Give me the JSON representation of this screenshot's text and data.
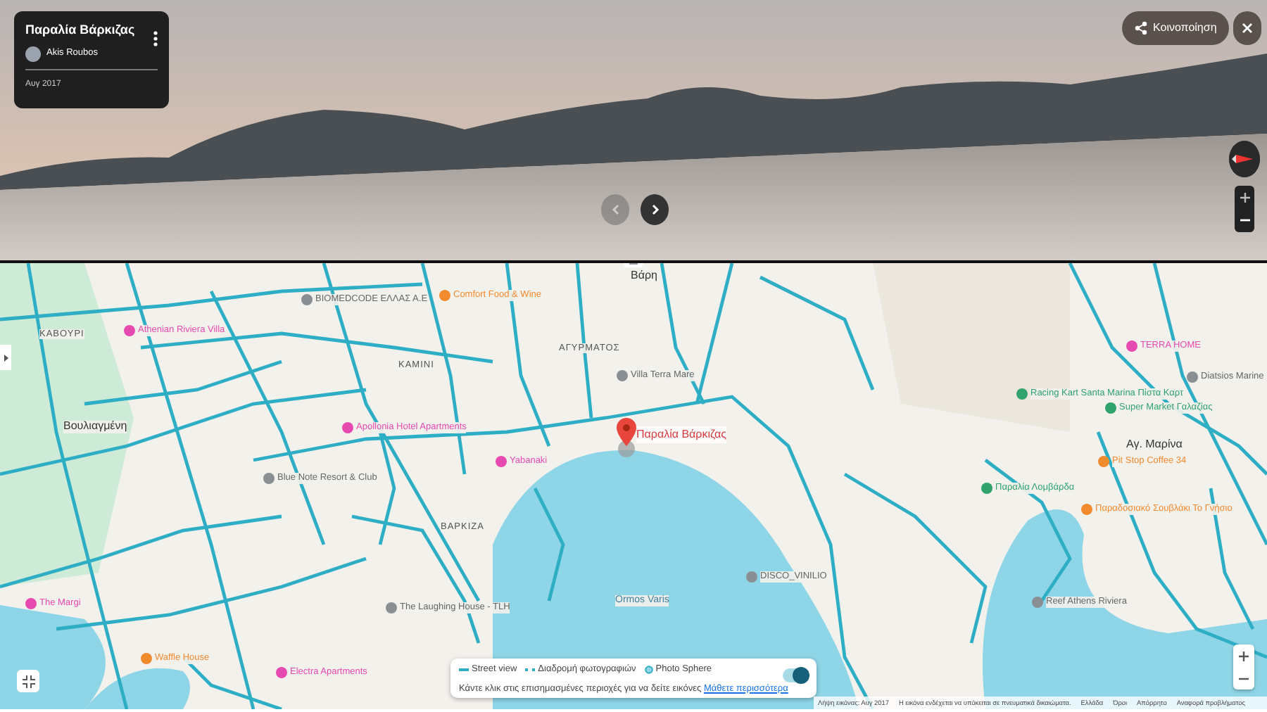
{
  "street_view": {
    "title": "Παραλία Βάρκιζας",
    "author": "Akis Roubos",
    "date": "Αυγ 2017",
    "share_label": "Κοινοποίηση",
    "nav": [
      {
        "kind": "prev",
        "disabled": true
      },
      {
        "kind": "next",
        "disabled": false
      }
    ]
  },
  "map": {
    "pin_label": "Παραλία Βάρκιζας",
    "places": [
      {
        "name": "Βάρη",
        "kind": "town"
      },
      {
        "name": "Comfort Food & Wine",
        "kind": "poi",
        "color": "#f28a2e"
      },
      {
        "name": "BIOMEDCODE ΕΛΛΑΣ Α.Ε",
        "kind": "poi",
        "color": "#8a8f94"
      },
      {
        "name": "Athenian Riviera Villa",
        "kind": "poi",
        "color": "#e64ab0"
      },
      {
        "name": "ΚΑΒΟΥΡΙ",
        "kind": "area"
      },
      {
        "name": "TERRA HOME",
        "kind": "poi",
        "color": "#e64ab0"
      },
      {
        "name": "ΑΓΥΡΜΑΤΟΣ",
        "kind": "area"
      },
      {
        "name": "ΚΑΜΙΝΙ",
        "kind": "area"
      },
      {
        "name": "Villa Terra Mare",
        "kind": "poi",
        "color": "#8a8f94"
      },
      {
        "name": "Diatsios Marine",
        "kind": "poi",
        "color": "#8a8f94"
      },
      {
        "name": "Racing Kart Santa Marina Πίστα Καρτ",
        "kind": "poi",
        "color": "#2fa36b"
      },
      {
        "name": "Super Market Γαλαζίας",
        "kind": "poi",
        "color": "#2fa36b"
      },
      {
        "name": "Βουλιαγμένη",
        "kind": "town"
      },
      {
        "name": "Apollonia Hotel Apartments",
        "kind": "poi",
        "color": "#e64ab0"
      },
      {
        "name": "Αγ. Μαρίνα",
        "kind": "town"
      },
      {
        "name": "Yabanaki",
        "kind": "poi",
        "color": "#e64ab0"
      },
      {
        "name": "Pit Stop Coffee 34",
        "kind": "poi",
        "color": "#f28a2e"
      },
      {
        "name": "Blue Note Resort & Club",
        "kind": "poi",
        "color": "#8a8f94"
      },
      {
        "name": "Παραλία Λομβάρδα",
        "kind": "poi",
        "color": "#2fa36b"
      },
      {
        "name": "Παραδοσιακό Σουβλάκι Το Γνήσιο",
        "kind": "poi",
        "color": "#f28a2e"
      },
      {
        "name": "ΒΑΡΚΙΖΑ",
        "kind": "area"
      },
      {
        "name": "DISCO_VINILIO",
        "kind": "poi",
        "color": "#8a8f94"
      },
      {
        "name": "The Margi",
        "kind": "poi",
        "color": "#e64ab0"
      },
      {
        "name": "The Laughing House - TLH",
        "kind": "poi",
        "color": "#8a8f94"
      },
      {
        "name": "Ormos Varis",
        "kind": "water"
      },
      {
        "name": "Reef Athens Riviera",
        "kind": "poi",
        "color": "#8a8f94"
      },
      {
        "name": "Waffle House",
        "kind": "poi",
        "color": "#f28a2e"
      },
      {
        "name": "Electra Apartments",
        "kind": "poi",
        "color": "#e64ab0"
      }
    ]
  },
  "legend": {
    "items": [
      {
        "label": "Street view",
        "kind": "line"
      },
      {
        "label": "Διαδρομή φωτογραφιών",
        "kind": "dotted"
      },
      {
        "label": "Photo Sphere",
        "kind": "circle"
      }
    ],
    "hint": "Κάντε κλικ στις επισημασμένες περιοχές για να δείτε εικόνες",
    "link": "Μάθετε περισσότερα",
    "toggle_on": true
  },
  "footer": [
    "Λήψη εικόνας: Αυγ 2017",
    "Η εικόνα ενδέχεται να υπόκειται σε πνευματικά δικαιώματα.",
    "Ελλάδα",
    "Όροι",
    "Απόρρητο",
    "Αναφορά προβλήματος"
  ]
}
